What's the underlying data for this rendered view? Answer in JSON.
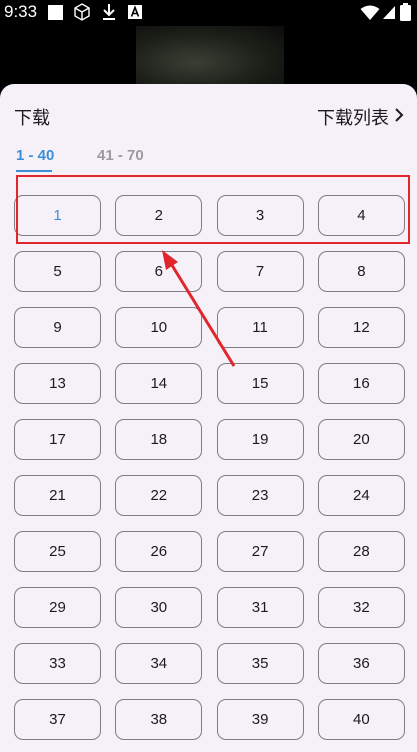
{
  "status_bar": {
    "time": "9:33",
    "icons": [
      "notification-square-icon",
      "cube-icon",
      "download-icon",
      "app-a-icon",
      "wifi-icon",
      "signal-icon",
      "battery-icon"
    ]
  },
  "sheet": {
    "title": "下载",
    "list_link_label": "下载列表",
    "tabs": [
      {
        "label": "1 - 40",
        "active": true
      },
      {
        "label": "41 - 70",
        "active": false
      }
    ],
    "episodes": [
      "1",
      "2",
      "3",
      "4",
      "5",
      "6",
      "7",
      "8",
      "9",
      "10",
      "11",
      "12",
      "13",
      "14",
      "15",
      "16",
      "17",
      "18",
      "19",
      "20",
      "21",
      "22",
      "23",
      "24",
      "25",
      "26",
      "27",
      "28",
      "29",
      "30",
      "31",
      "32",
      "33",
      "34",
      "35",
      "36",
      "37",
      "38",
      "39",
      "40"
    ],
    "selected_episode": "1"
  },
  "colors": {
    "accent": "#3b8fd8",
    "sheet_bg": "#f6f1f8",
    "annotation": "#e0262c"
  }
}
